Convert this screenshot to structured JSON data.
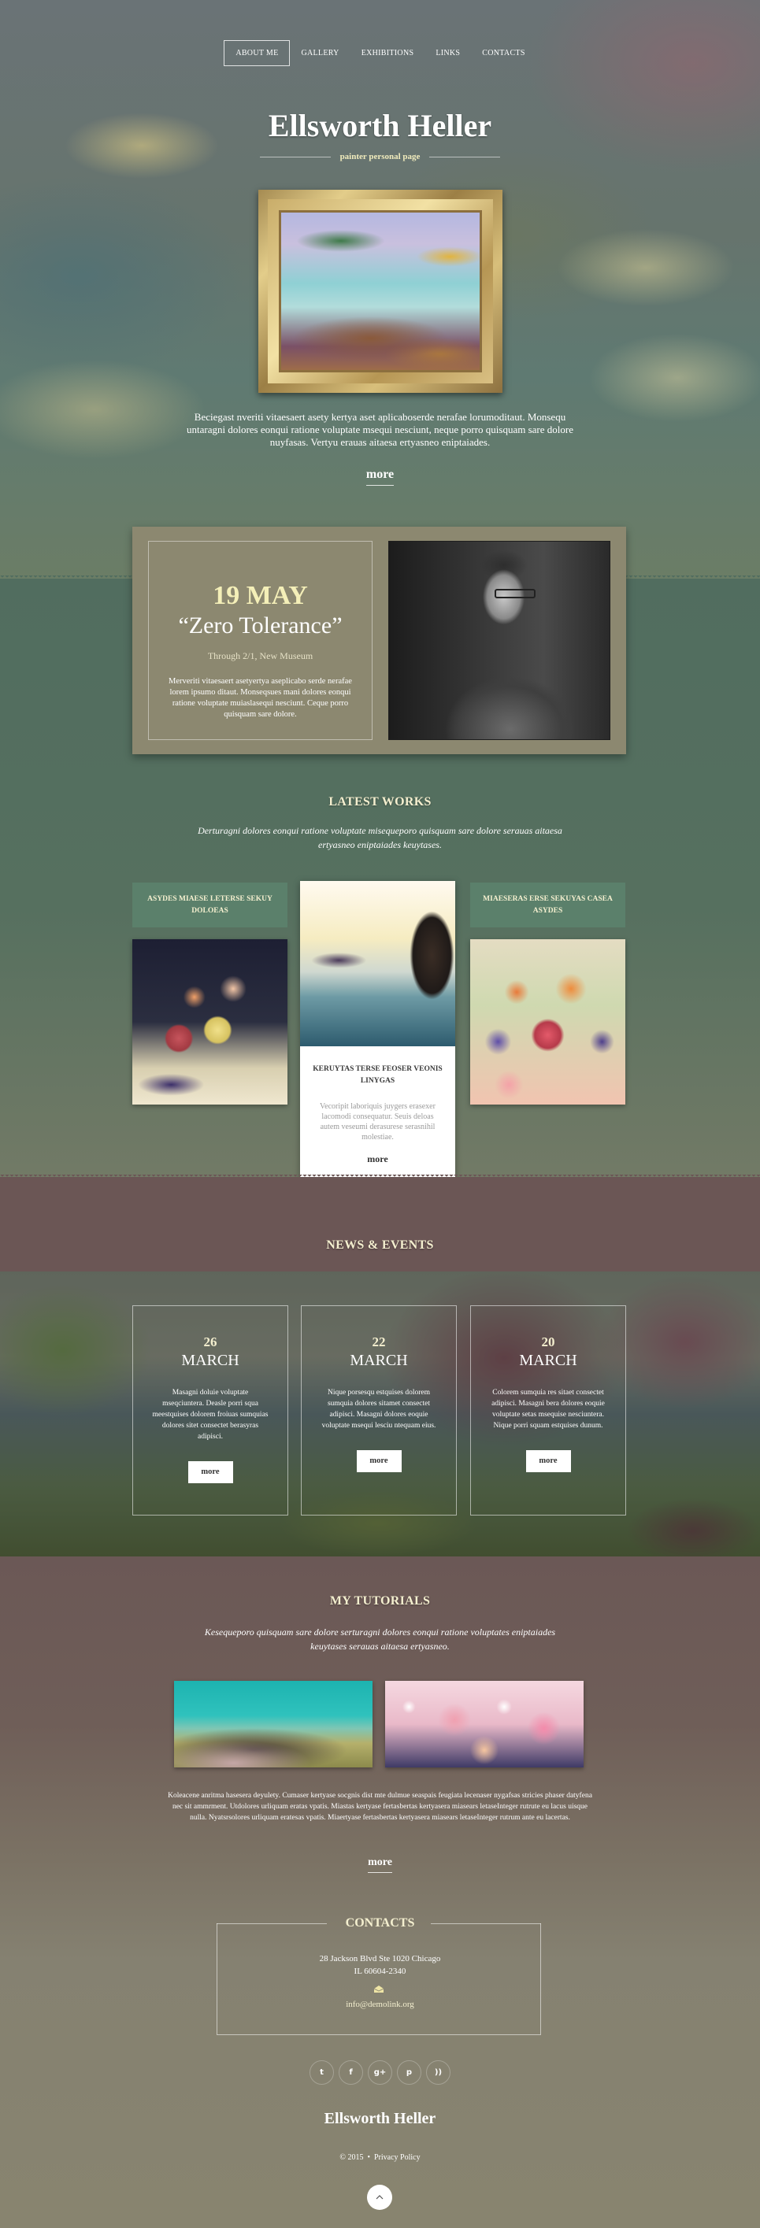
{
  "nav": {
    "items": [
      {
        "label": "ABOUT ME",
        "active": true
      },
      {
        "label": "GALLERY",
        "active": false
      },
      {
        "label": "EXHIBITIONS",
        "active": false
      },
      {
        "label": "LINKS",
        "active": false
      },
      {
        "label": "CONTACTS",
        "active": false
      }
    ]
  },
  "hero": {
    "title": "Ellsworth Heller",
    "tagline": "painter personal page",
    "text": "Beciegast nveriti vitaesaert asety kertya aset aplicaboserde nerafae lorumoditaut. Monsequ untaragni dolores eonqui ratione voluptate msequi nesciunt, neque porro quisquam sare dolore nuyfasas. Vertyu erauas aitaesa ertyasneo eniptaiades.",
    "more_label": "more"
  },
  "event": {
    "date": "19 MAY",
    "title": "“Zero Tolerance”",
    "venue": "Through 2/1, New Museum",
    "description": "Merveriti vitaesaert asetyertya aseplicabo serde nerafae lorem ipsumo ditaut. Monseqsues mani dolores eonqui ratione voluptate muiaslasequi nesciunt. Ceque porro quisquam sare dolore."
  },
  "latest_works": {
    "title": "LATEST WORKS",
    "subtitle": "Derturagni dolores eonqui ratione voluptate misequeporo quisquam sare dolore serauas aitaesa ertyasneo eniptaiades keuytases.",
    "items": [
      {
        "title": "ASYDES MIAESE LETERSE SEKUY DOLOEAS"
      },
      {
        "title": "KERUYTAS TERSE FEOSER VEONIS LINYGAS",
        "description": "Vecoripit laboriquis juygers erasexer lacomodi consequatur. Seuis deloas autem veseumi derasurese serasnihil molestiae.",
        "more_label": "more"
      },
      {
        "title": "MIAESERAS ERSE SEKUYAS CASEA ASYDES"
      }
    ]
  },
  "news": {
    "title": "NEWS & EVENTS",
    "items": [
      {
        "day": "26",
        "month": "MARCH",
        "text": "Masagni doluie voluptate mseqciuntera. Deasle porri squa meestquises dolorem froiuas sumquias dolores sitet consectet berasyras adipisci.",
        "more_label": "more"
      },
      {
        "day": "22",
        "month": "MARCH",
        "text": "Nique porsesqu estquises dolorem sumquia dolores sitamet consectet adipisci. Masagni dolores eoquie voluptate msequi lesciu ntequam eius.",
        "more_label": "more"
      },
      {
        "day": "20",
        "month": "MARCH",
        "text": "Colorem sumquia res sitaet consectet adipisci. Masagni bera dolores eoquie voluptate setas msequise nesciuntera. Nique porri squam estquises dunum.",
        "more_label": "more"
      }
    ]
  },
  "tutorials": {
    "title": "MY TUTORIALS",
    "subtitle": "Kesequeporo quisquam sare dolore serturagni dolores eonqui ratione voluptates eniptaiades keuytases serauas aitaesa ertyasneo.",
    "text": "Koleacene anritma hasesera deyulety. Cumaser kertyase socgnis dist mte dulmue seaspais feugiata lecenaser nygafsas stricies phaser datyfena nec sit ammrment. Utdolores urliquam eratas vpatis. Miastas kertyase fertasbertas kertyasera miasears letaseInteger rutrute eu lacus uisque nulla. Nyatsrsolores urliquam eratesas vpatis. Miaertyase fertasbertas kertyasera miasears letaseInteger rutrum ante eu lacertas.",
    "more_label": "more"
  },
  "contacts": {
    "title": "CONTACTS",
    "address_line1": "28 Jackson Blvd Ste 1020 Chicago",
    "address_line2": "IL 60604-2340",
    "email": "info@demolink.org"
  },
  "social": [
    {
      "icon": "twitter-icon",
      "glyph": "t"
    },
    {
      "icon": "facebook-icon",
      "glyph": "f"
    },
    {
      "icon": "google-plus-icon",
      "glyph": "g+"
    },
    {
      "icon": "pinterest-icon",
      "glyph": "p"
    },
    {
      "icon": "rss-icon",
      "glyph": "))"
    }
  ],
  "footer": {
    "name": "Ellsworth Heller",
    "copyright": "© 2015",
    "separator": "•",
    "privacy_label": "Privacy Policy"
  },
  "colors": {
    "accent_cream": "#f4efcf",
    "green_band": "#516d5f",
    "work_label_bg": "#5b806b",
    "news_header_bg": "#6b5655",
    "event_card_bg": "#8c8870",
    "footer_bg": "#88846f"
  }
}
